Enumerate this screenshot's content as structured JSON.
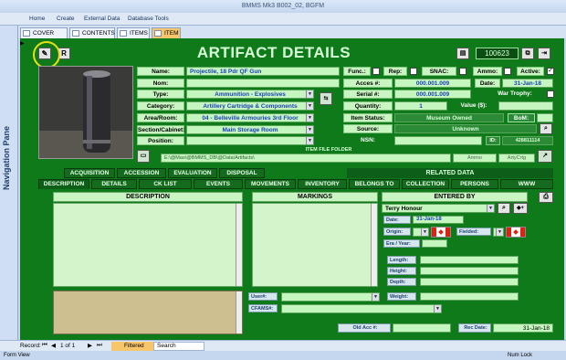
{
  "window": {
    "title": "BMMS Mk3 B002_02, BGFM"
  },
  "ribbon": {
    "items": [
      "Home",
      "Create",
      "External Data",
      "Database Tools"
    ]
  },
  "nav_pane": {
    "label": "Navigation Pane"
  },
  "doc_tabs": [
    "COVER PAGE",
    "CONTENTS",
    "ITEMS",
    "ITEM"
  ],
  "header": {
    "r_button": "R",
    "title": "ARTIFACT DETAILS",
    "record_number": "100623"
  },
  "fields": {
    "name": {
      "label": "Name:",
      "value": "Projectile, 18 Pdr QF Gun"
    },
    "nom": {
      "label": "Nom:",
      "value": ""
    },
    "type": {
      "label": "Type:",
      "value": "Ammunition - Explosives"
    },
    "category": {
      "label": "Category:",
      "value": "Artillery Cartridge & Components"
    },
    "area": {
      "label": "Area/Room:",
      "value": "04 - Belleville Armouries 3rd Floor"
    },
    "section": {
      "label": "Section/Cabinet:",
      "value": "Main Storage Room"
    },
    "position": {
      "label": "Position:",
      "value": ""
    },
    "func": {
      "label": "Func.:"
    },
    "rep": {
      "label": "Rep:"
    },
    "snac": {
      "label": "SNAC:"
    },
    "ammo": {
      "label": "Ammo:"
    },
    "active": {
      "label": "Active:"
    },
    "acces": {
      "label": "Acces #:",
      "value": "000.001.009"
    },
    "date": {
      "label": "Date:",
      "value": "31-Jan-18"
    },
    "serial": {
      "label": "Serial #:",
      "value": "000.001.009"
    },
    "war_trophy": {
      "label": "War Trophy:"
    },
    "quantity": {
      "label": "Quantity:",
      "value": "1"
    },
    "value": {
      "label": "Value ($):",
      "value": ""
    },
    "item_status": {
      "label": "Item Status:",
      "value": "Museum Owned"
    },
    "bom": {
      "label": "BoM:"
    },
    "source": {
      "label": "Source:",
      "value": "Unknown"
    },
    "nsn": {
      "label": "NSN:",
      "value": ""
    },
    "id_label": "ID:",
    "id_value": "428811114"
  },
  "file_folder": {
    "label": "ITEM FILE FOLDER",
    "path": "E:\\@Mas\\@BMMS_DB\\@Data\\Artifacts\\",
    "ammo": "Ammo",
    "arty": "ArtyCrtg"
  },
  "section_tabs_row1": [
    "ACQUISITION",
    "ACCESSION",
    "EVALUATION",
    "DISPOSAL"
  ],
  "related_data": "RELATED DATA",
  "section_tabs_row2": [
    "DESCRIPTION",
    "DETAILS",
    "CK LIST",
    "EVENTS",
    "MOVEMENTS",
    "INVENTORY",
    "BELONGS TO",
    "COLLECTION",
    "PERSONS",
    "WWW"
  ],
  "panels": {
    "description": "DESCRIPTION",
    "markings": "MARKINGS",
    "entered_by": "ENTERED BY",
    "entered_by_value": "Terry Honour",
    "date_label": "Date:",
    "date_value": "31-Jan-18",
    "origin_label": "Origin:",
    "fielded_label": "Fielded:",
    "era_label": "Era / Year:",
    "length_label": "Length:",
    "height_label": "Height:",
    "depth_label": "Depth:",
    "weight_label": "Weight:",
    "user_label": "User#:",
    "cfams_label": "CFAMS#:",
    "old_acc_label": "Old Acc #:",
    "rec_date_label": "Rec Date:",
    "rec_date_value": "31-Jan-18"
  },
  "record_nav": {
    "label": "Record:",
    "position": "1 of 1",
    "filter": "Filtered",
    "search": "Search"
  },
  "statusbar": {
    "left": "Form View",
    "right": "Num Lock"
  },
  "colors": {
    "form_bg": "#0f7a1a",
    "field_bg": "#c6f6c0",
    "value_text": "#1a3fb8"
  }
}
